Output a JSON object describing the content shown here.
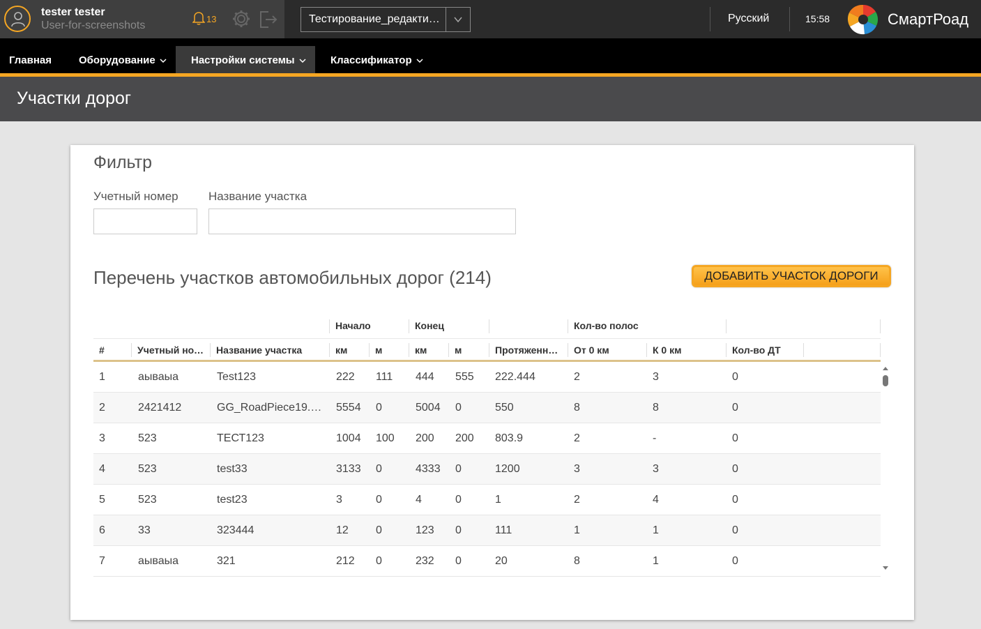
{
  "user": {
    "name": "tester tester",
    "login": "User-for-screenshots"
  },
  "notifications": {
    "count": "13"
  },
  "project": {
    "selected": "Тестирование_редактирования"
  },
  "language": "Русский",
  "time": "15:58",
  "brand": {
    "name": "СмартРоад"
  },
  "nav": {
    "items": [
      {
        "label": "Главная"
      },
      {
        "label": "Оборудование"
      },
      {
        "label": "Настройки системы"
      },
      {
        "label": "Классификатор"
      }
    ],
    "active": "Настройки системы"
  },
  "page": {
    "title": "Участки дорог"
  },
  "filter": {
    "title": "Фильтр",
    "account_label": "Учетный номер",
    "account_value": "",
    "name_label": "Название участка",
    "name_value": ""
  },
  "list": {
    "title": "Перечень участков автомобильных дорог (214)",
    "add_button": "ДОБАВИТЬ УЧАСТОК ДОРОГИ"
  },
  "table": {
    "groups": {
      "start": "Начало",
      "end": "Конец",
      "lanes": "Кол-во полос"
    },
    "headers": {
      "num": "#",
      "account": "Учетный номер",
      "name": "Название участка",
      "start_km": "км",
      "start_m": "м",
      "end_km": "км",
      "end_m": "м",
      "length": "Протяженность",
      "from0": "От 0 км",
      "to0": "К 0 км",
      "dt": "Кол-во ДТ"
    },
    "rows": [
      [
        "1",
        "аываыа",
        "Test123",
        "222",
        "111",
        "444",
        "555",
        "222.444",
        "2",
        "3",
        "0"
      ],
      [
        "2",
        "2421412",
        "GG_RoadPiece19.0...",
        "5554",
        "0",
        "5004",
        "0",
        "550",
        "8",
        "8",
        "0"
      ],
      [
        "3",
        "523",
        "ТЕСТ123",
        "1004",
        "100",
        "200",
        "200",
        "803.9",
        "2",
        "-",
        "0"
      ],
      [
        "4",
        "523",
        "test33",
        "3133",
        "0",
        "4333",
        "0",
        "1200",
        "3",
        "3",
        "0"
      ],
      [
        "5",
        "523",
        "test23",
        "3",
        "0",
        "4",
        "0",
        "1",
        "2",
        "4",
        "0"
      ],
      [
        "6",
        "33",
        "323444",
        "12",
        "0",
        "123",
        "0",
        "111",
        "1",
        "1",
        "0"
      ],
      [
        "7",
        "аываыа",
        "321",
        "212",
        "0",
        "232",
        "0",
        "20",
        "8",
        "1",
        "0"
      ]
    ]
  },
  "colors": {
    "accent": "#f5a623",
    "header_bg": "#2b2b2b",
    "nav_bg": "#000000",
    "page_header_bg": "#4a4a4c"
  }
}
